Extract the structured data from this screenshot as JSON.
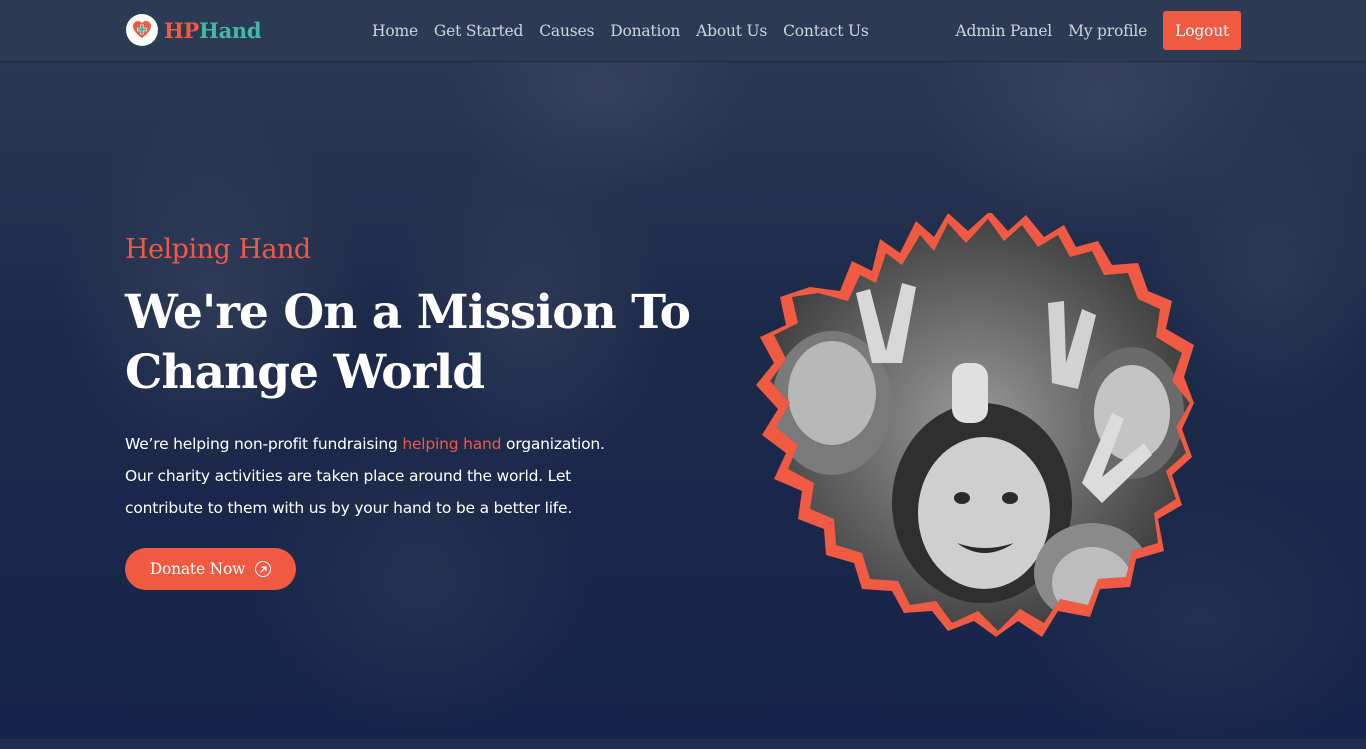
{
  "brand": {
    "name_part1": "HP",
    "name_part2": "Hand",
    "logo_icon": "heart-cross-icon"
  },
  "nav": {
    "links": [
      "Home",
      "Get Started",
      "Causes",
      "Donation",
      "About Us",
      "Contact Us"
    ],
    "admin_label": "Admin Panel",
    "profile_label": "My profile",
    "logout_label": "Logout"
  },
  "hero": {
    "subtitle": "Helping Hand",
    "title_line1": "We're On a Mission To",
    "title_line2": "Change World",
    "desc_part1": "We’re helping non-profit fundraising ",
    "desc_highlight": "helping hand",
    "desc_part2": " organization. Our charity activities are taken place around the world. Let contribute to them with us by your hand to be a better life.",
    "donate_label": "Donate Now",
    "donate_icon": "arrow-up-right-circle-icon",
    "image_alt": "children-photo"
  },
  "colors": {
    "accent": "#f05a43",
    "brand_teal": "#45b8a4",
    "navbar": "#2b3b54",
    "hero_bg": "#15244a"
  }
}
